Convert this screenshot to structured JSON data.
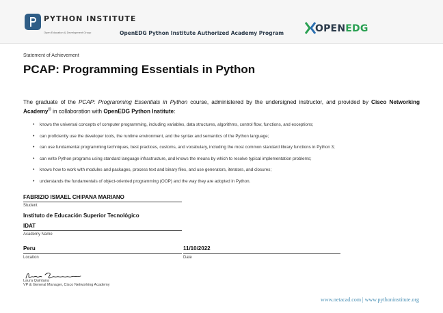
{
  "header": {
    "pi_brand": "PYTHON INSTITUTE",
    "pi_subtitle": "Open Education & Development Group",
    "program": "OpenEDG Python Institute Authorized Academy Program",
    "openedg_open": "OPEN",
    "openedg_edg": "EDG"
  },
  "certificate": {
    "statement": "Statement of Achievement",
    "title": "PCAP: Programming Essentials in Python",
    "intro": {
      "p1": "The graduate of the ",
      "course": "PCAP: Programming Essentials in Python",
      "p2": " course, administered by the undersigned instructor, and provided by ",
      "cisco": "Cisco Networking Academy",
      "reg": "®",
      "p3": " in collaboration with ",
      "openedg": "OpenEDG Python Institute",
      "p4": ":"
    },
    "skills": [
      "knows the universal concepts of computer programming, including variables, data structures, algorithms, control flow, functions, and exceptions;",
      "can proficiently use the developer tools, the runtime environment, and the syntax and semantics of the Python language;",
      "can use fundamental programming techniques, best practices, customs, and vocabulary, including the most common standard library functions in Python 3;",
      "can write Python programs using standard language infrastructure, and knows the means by which to resolve typical implementation problems;",
      "knows how to work with modules and packages, process text and binary files, and use generators, iterators, and closures;",
      "understands the fundamentals of object-oriented programming (OOP) and the way they are adopted in Python."
    ]
  },
  "fields": {
    "student_value": "FABRIZIO ISMAEL CHIPANA MARIANO",
    "student_label": "Student",
    "institution_value": "Instituto de Educación Superior Tecnológico",
    "academy_value": "IDAT",
    "academy_label": "Academy Name",
    "location_value": "Peru",
    "location_label": "Location",
    "date_value": "11/10/2022",
    "date_label": "Date"
  },
  "signatory": {
    "name": "Laura Quintana",
    "role": "VP & General Manager, Cisco Networking Academy"
  },
  "footer": {
    "urls": "www.netacad.com | www.pythoninstitute.org"
  }
}
